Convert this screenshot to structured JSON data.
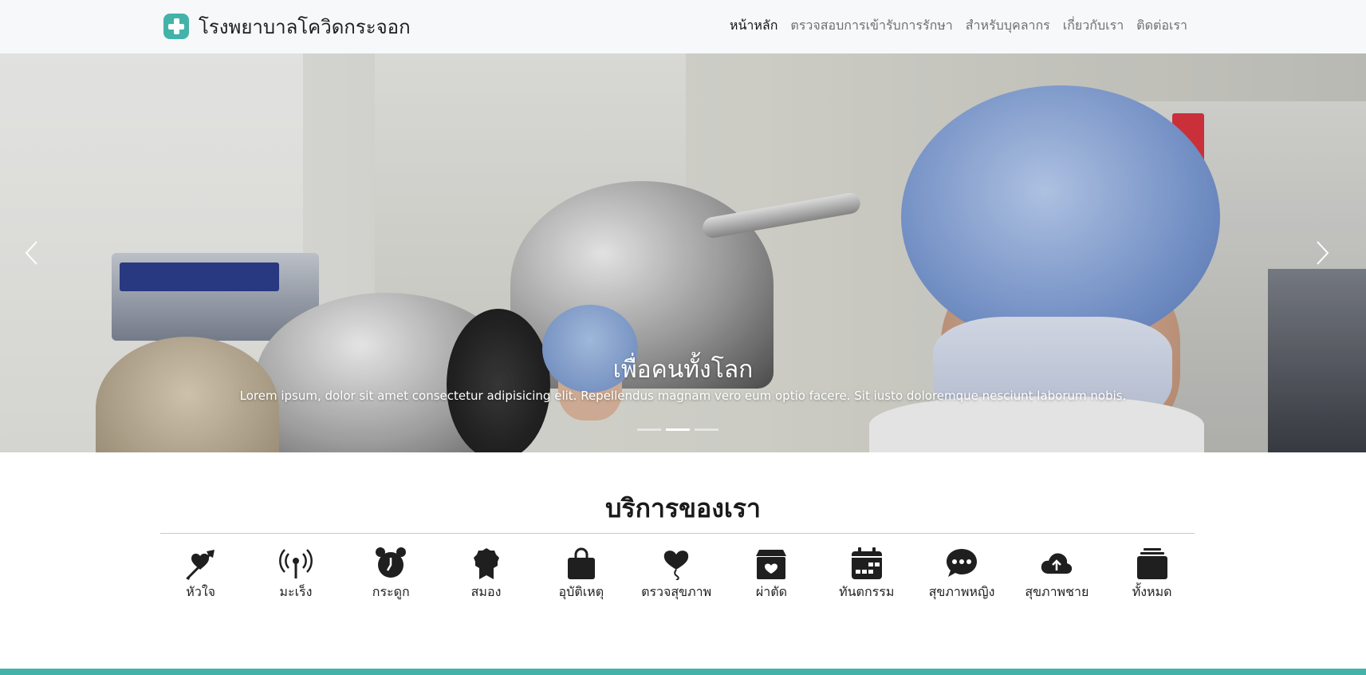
{
  "brand": {
    "name": "โรงพยาบาลโควิดกระจอก"
  },
  "nav": {
    "items": [
      {
        "label": "หน้าหลัก"
      },
      {
        "label": "ตรวจสอบการเข้ารับการรักษา"
      },
      {
        "label": "สำหรับบุคลากร"
      },
      {
        "label": "เกี่ยวกับเรา"
      },
      {
        "label": "ติดต่อเรา"
      }
    ],
    "active_index": 0
  },
  "carousel": {
    "title": "เพื่อคนทั้งโลก",
    "text": "Lorem ipsum, dolor sit amet consectetur adipisicing elit. Repellendus magnam vero eum optio facere. Sit iusto doloremque nesciunt laborum nobis.",
    "slides": 3,
    "active_slide": 1,
    "prev_icon": "chevron-left-icon",
    "next_icon": "chevron-right-icon"
  },
  "services": {
    "title": "บริการของเรา",
    "items": [
      {
        "label": "หัวใจ",
        "icon": "heart-arrow-icon"
      },
      {
        "label": "มะเร็ง",
        "icon": "broadcast-icon"
      },
      {
        "label": "กระดูก",
        "icon": "alarm-clock-icon"
      },
      {
        "label": "สมอง",
        "icon": "award-badge-icon"
      },
      {
        "label": "อุบัติเหตุ",
        "icon": "shopping-bag-icon"
      },
      {
        "label": "ตรวจสุขภาพ",
        "icon": "balloon-heart-icon"
      },
      {
        "label": "ผ่าตัด",
        "icon": "box-heart-icon"
      },
      {
        "label": "ทันตกรรม",
        "icon": "calendar-icon"
      },
      {
        "label": "สุขภาพหญิง",
        "icon": "chat-dots-icon"
      },
      {
        "label": "สุขภาพชาย",
        "icon": "cloud-upload-icon"
      },
      {
        "label": "ทั้งหมด",
        "icon": "collection-icon"
      }
    ]
  },
  "colors": {
    "accent": "#43b3aa",
    "navbar_bg": "#f6f8fa"
  }
}
